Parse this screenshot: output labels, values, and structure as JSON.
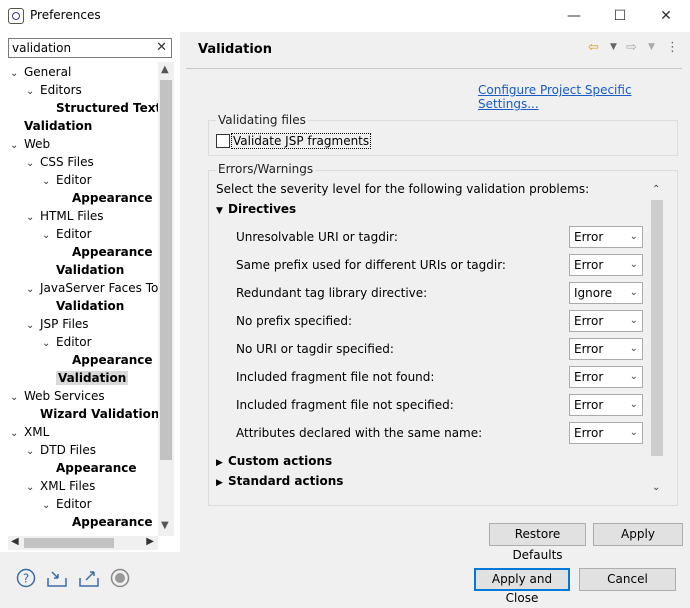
{
  "window": {
    "title": "Preferences",
    "minimize": "—",
    "maximize": "☐",
    "close": "✕"
  },
  "filter": {
    "value": "validation"
  },
  "tree": [
    {
      "label": "General",
      "depth": 0,
      "twisty": "down",
      "bold": false
    },
    {
      "label": "Editors",
      "depth": 1,
      "twisty": "down",
      "bold": false
    },
    {
      "label": "Structured Text",
      "depth": 2,
      "twisty": "",
      "bold": true
    },
    {
      "label": "Validation",
      "depth": 0,
      "twisty": "",
      "bold": true
    },
    {
      "label": "Web",
      "depth": 0,
      "twisty": "down",
      "bold": false
    },
    {
      "label": "CSS Files",
      "depth": 1,
      "twisty": "down",
      "bold": false
    },
    {
      "label": "Editor",
      "depth": 2,
      "twisty": "down",
      "bold": false
    },
    {
      "label": "Appearance",
      "depth": 3,
      "twisty": "",
      "bold": true
    },
    {
      "label": "HTML Files",
      "depth": 1,
      "twisty": "down",
      "bold": false
    },
    {
      "label": "Editor",
      "depth": 2,
      "twisty": "down",
      "bold": false
    },
    {
      "label": "Appearance",
      "depth": 3,
      "twisty": "",
      "bold": true
    },
    {
      "label": "Validation",
      "depth": 2,
      "twisty": "",
      "bold": true
    },
    {
      "label": "JavaServer Faces Too",
      "depth": 1,
      "twisty": "down",
      "bold": false
    },
    {
      "label": "Validation",
      "depth": 2,
      "twisty": "",
      "bold": true
    },
    {
      "label": "JSP Files",
      "depth": 1,
      "twisty": "down",
      "bold": false
    },
    {
      "label": "Editor",
      "depth": 2,
      "twisty": "down",
      "bold": false
    },
    {
      "label": "Appearance",
      "depth": 3,
      "twisty": "",
      "bold": true
    },
    {
      "label": "Validation",
      "depth": 2,
      "twisty": "",
      "bold": true,
      "selected": true
    },
    {
      "label": "Web Services",
      "depth": 0,
      "twisty": "down",
      "bold": false
    },
    {
      "label": "Wizard Validation",
      "depth": 1,
      "twisty": "",
      "bold": true
    },
    {
      "label": "XML",
      "depth": 0,
      "twisty": "down",
      "bold": false
    },
    {
      "label": "DTD Files",
      "depth": 1,
      "twisty": "down",
      "bold": false
    },
    {
      "label": "Appearance",
      "depth": 2,
      "twisty": "",
      "bold": true
    },
    {
      "label": "XML Files",
      "depth": 1,
      "twisty": "down",
      "bold": false
    },
    {
      "label": "Editor",
      "depth": 2,
      "twisty": "down",
      "bold": false
    },
    {
      "label": "Appearance",
      "depth": 3,
      "twisty": "",
      "bold": true
    }
  ],
  "page": {
    "title": "Validation",
    "config_link": "Configure Project Specific Settings...",
    "validating_files": {
      "label": "Validating files",
      "checkbox_label": "Validate JSP fragments",
      "checked": false
    },
    "errors_warnings": {
      "label": "Errors/Warnings",
      "intro": "Select the severity level for the following validation problems:",
      "directives": "Directives",
      "rows": [
        {
          "label": "Unresolvable URI or tagdir:",
          "value": "Error"
        },
        {
          "label": "Same prefix used for different URIs or tagdir:",
          "value": "Error"
        },
        {
          "label": "Redundant tag library directive:",
          "value": "Ignore"
        },
        {
          "label": "No prefix specified:",
          "value": "Error"
        },
        {
          "label": "No URI or tagdir specified:",
          "value": "Error"
        },
        {
          "label": "Included fragment file not found:",
          "value": "Error"
        },
        {
          "label": "Included fragment file not specified:",
          "value": "Error"
        },
        {
          "label": "Attributes declared with the same name:",
          "value": "Error"
        }
      ],
      "custom_actions": "Custom actions",
      "standard_actions": "Standard actions"
    }
  },
  "buttons": {
    "restore_defaults": "Restore Defaults",
    "apply": "Apply",
    "apply_and_close": "Apply and Close",
    "cancel": "Cancel"
  },
  "icons": {
    "help": "help-icon",
    "import": "import-icon",
    "export": "export-icon",
    "record": "record-icon",
    "back": "back-arrow-icon",
    "forward": "forward-arrow-icon"
  }
}
